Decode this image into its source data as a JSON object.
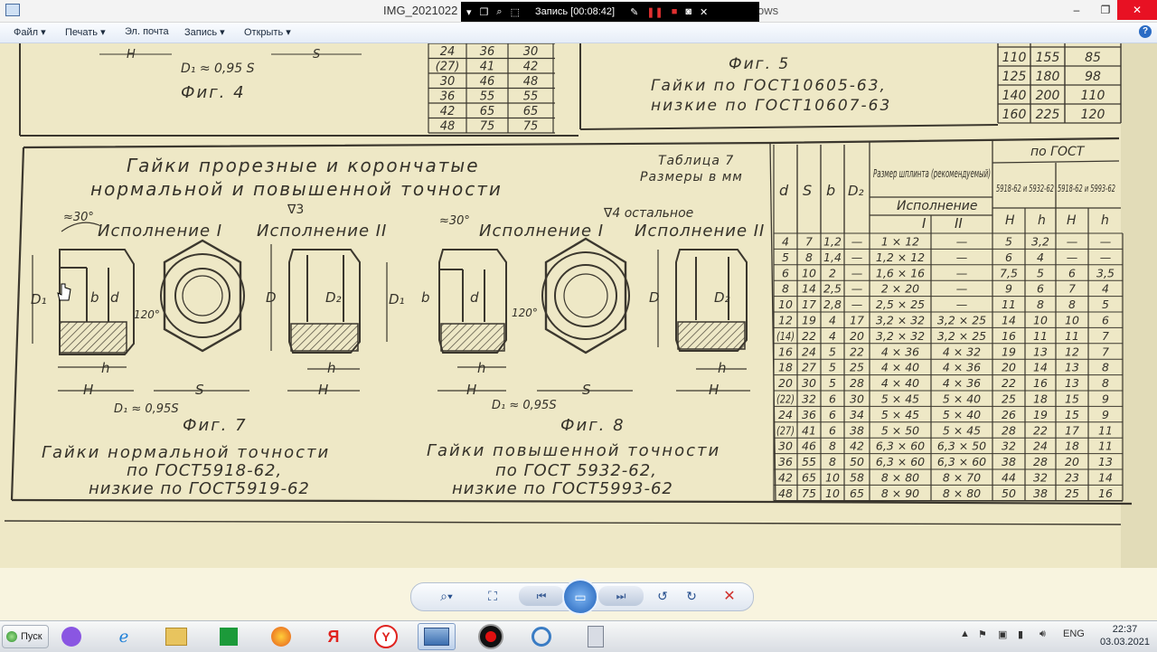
{
  "window": {
    "title_prefix": "IMG_2021022",
    "title_suffix": "ows",
    "controls": {
      "minimize": "–",
      "restore": "❐",
      "close": "✕"
    }
  },
  "recorder": {
    "label": "Запись [00:08:42]"
  },
  "menu": {
    "items": [
      {
        "label": "Файл",
        "has_arrow": true
      },
      {
        "label": "Печать",
        "has_arrow": true
      },
      {
        "label": "Эл. почта",
        "has_arrow": false
      },
      {
        "label": "Запись",
        "has_arrow": true
      },
      {
        "label": "Открыть",
        "has_arrow": true
      }
    ],
    "help": "?"
  },
  "document": {
    "fig4": {
      "approx": "D₁ ≈ 0,95 S",
      "caption": "Фиг. 4",
      "dims": [
        "H",
        "S"
      ]
    },
    "top_table_rows": [
      [
        "24",
        "36",
        "30"
      ],
      [
        "(27)",
        "41",
        "42"
      ],
      [
        "30",
        "46",
        "48"
      ],
      [
        "36",
        "55",
        "55"
      ],
      [
        "42",
        "65",
        "65"
      ],
      [
        "48",
        "75",
        "75"
      ]
    ],
    "fig5": {
      "caption": "Фиг. 5",
      "line1": "Гайки по ГОСТ10605-63,",
      "line2": "низкие по ГОСТ10607-63"
    },
    "right_top_rows": [
      [
        "110",
        "155",
        "85"
      ],
      [
        "125",
        "180",
        "98"
      ],
      [
        "140",
        "200",
        "110"
      ],
      [
        "160",
        "225",
        "120"
      ]
    ],
    "main_title_1": "Гайки прорезные и корончатые",
    "main_title_2": "нормальной и повышенной точности",
    "table_caption_1": "Таблица 7",
    "table_caption_2": "Размеры в мм",
    "roughness_1": "∇3",
    "roughness_2": "∇4 остальное",
    "exec_1a": "Исполнение I",
    "exec_1b": "Исполнение II",
    "exec_2a": "Исполнение I",
    "exec_2b": "Исполнение II",
    "angle_30a": "≈30°",
    "angle_30b": "≈30°",
    "angle_120a": "120°",
    "angle_120b": "120°",
    "approx_7": "D₁ ≈ 0,95S",
    "approx_8": "D₁ ≈ 0,95S",
    "fig7_caption": "Фиг. 7",
    "fig8_caption": "Фиг. 8",
    "fig7_line1": "Гайки нормальной точности",
    "fig7_line2": "по ГОСТ5918-62,",
    "fig7_line3": "низкие по ГОСТ5919-62",
    "fig8_line1": "Гайки повышенной точности",
    "fig8_line2": "по ГОСТ 5932-62,",
    "fig8_line3": "низкие по ГОСТ5993-62",
    "dim_labels": {
      "D1": "D₁",
      "D": "D",
      "D2": "D₂",
      "d": "d",
      "b": "b",
      "h": "h",
      "H": "H",
      "S": "S"
    },
    "table": {
      "col_d": "d",
      "col_s": "S",
      "col_b": "b",
      "col_d2": "D₂",
      "splint_header": "Размер шплинта (рекомендуемый)",
      "exec_header": "Исполнение",
      "exec_I": "I",
      "exec_II": "II",
      "gost_header": "по ГОСТ",
      "gost_a": "5918-62 и 5932-62",
      "gost_b": "5918-62 и 5993-62",
      "H": "H",
      "h": "h",
      "rows": [
        [
          "4",
          "7",
          "1,2",
          "—",
          "1 × 12",
          "—",
          "5",
          "3,2",
          "—",
          "—"
        ],
        [
          "5",
          "8",
          "1,4",
          "—",
          "1,2 × 12",
          "—",
          "6",
          "4",
          "—",
          "—"
        ],
        [
          "6",
          "10",
          "2",
          "—",
          "1,6 × 16",
          "—",
          "7,5",
          "5",
          "6",
          "3,5"
        ],
        [
          "8",
          "14",
          "2,5",
          "—",
          "2 × 20",
          "—",
          "9",
          "6",
          "7",
          "4"
        ],
        [
          "10",
          "17",
          "2,8",
          "—",
          "2,5 × 25",
          "—",
          "11",
          "8",
          "8",
          "5"
        ],
        [
          "12",
          "19",
          "4",
          "17",
          "3,2 × 32",
          "3,2 × 25",
          "14",
          "10",
          "10",
          "6"
        ],
        [
          "(14)",
          "22",
          "4",
          "20",
          "3,2 × 32",
          "3,2 × 25",
          "16",
          "11",
          "11",
          "7"
        ],
        [
          "16",
          "24",
          "5",
          "22",
          "4 × 36",
          "4 × 32",
          "19",
          "13",
          "12",
          "7"
        ],
        [
          "18",
          "27",
          "5",
          "25",
          "4 × 40",
          "4 × 36",
          "20",
          "14",
          "13",
          "8"
        ],
        [
          "20",
          "30",
          "5",
          "28",
          "4 × 40",
          "4 × 36",
          "22",
          "16",
          "13",
          "8"
        ],
        [
          "(22)",
          "32",
          "6",
          "30",
          "5 × 45",
          "5 × 40",
          "25",
          "18",
          "15",
          "9"
        ],
        [
          "24",
          "36",
          "6",
          "34",
          "5 × 45",
          "5 × 40",
          "26",
          "19",
          "15",
          "9"
        ],
        [
          "(27)",
          "41",
          "6",
          "38",
          "5 × 50",
          "5 × 45",
          "28",
          "22",
          "17",
          "11"
        ],
        [
          "30",
          "46",
          "8",
          "42",
          "6,3 × 60",
          "6,3 × 50",
          "32",
          "24",
          "18",
          "11"
        ],
        [
          "36",
          "55",
          "8",
          "50",
          "6,3 × 60",
          "6,3 × 60",
          "38",
          "28",
          "20",
          "13"
        ],
        [
          "42",
          "65",
          "10",
          "58",
          "8 × 80",
          "8 × 70",
          "44",
          "32",
          "23",
          "14"
        ],
        [
          "48",
          "75",
          "10",
          "65",
          "8 × 90",
          "8 × 80",
          "50",
          "38",
          "25",
          "16"
        ]
      ]
    }
  },
  "viewer_toolbar": {
    "zoom": "⌕▾",
    "fit": "⛶",
    "prev": "⏮",
    "slideshow": "▭",
    "next": "⏭",
    "rotate_left": "↺",
    "rotate_right": "↻",
    "delete": "✕"
  },
  "taskbar": {
    "start": "Пуск",
    "apps": [
      "alice",
      "ie",
      "explorer",
      "store",
      "firefox",
      "yandex",
      "yandex-browser",
      "photo-viewer",
      "recorder",
      "vpn",
      "calculator"
    ],
    "yandex_letter": "Я",
    "yandex_browser_letter": "Y",
    "lang": "ENG",
    "time": "22:37",
    "date": "03.03.2021"
  }
}
